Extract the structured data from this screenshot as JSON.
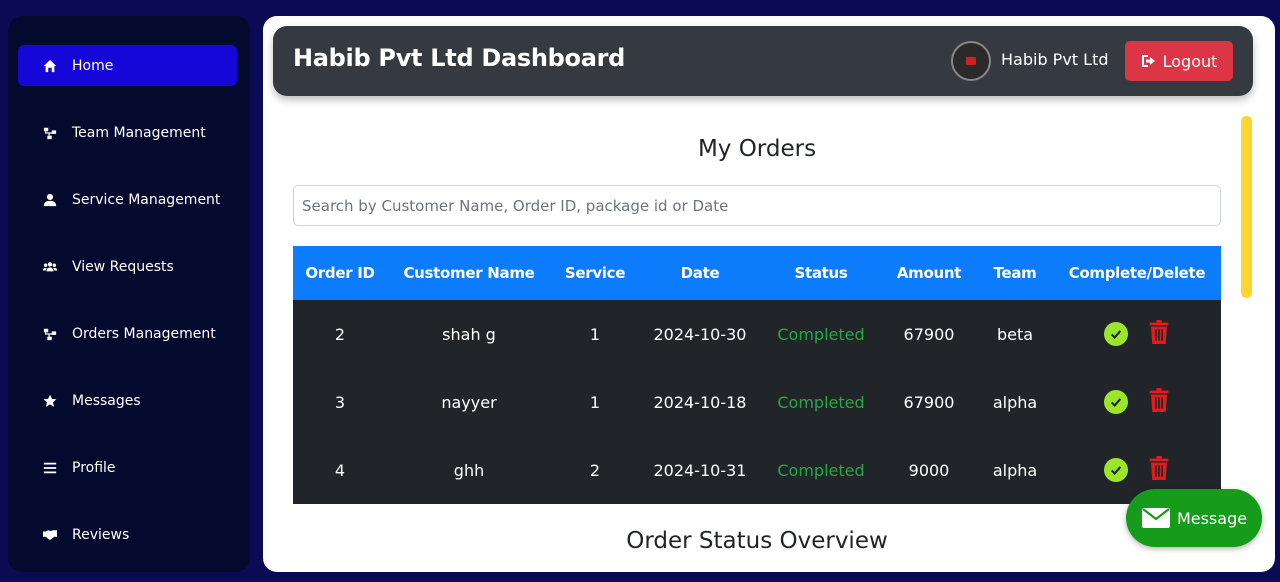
{
  "sidebar": {
    "items": [
      {
        "label": "Home",
        "icon": "home-icon",
        "active": true
      },
      {
        "label": "Team Management",
        "icon": "sitemap-icon"
      },
      {
        "label": "Service Management",
        "icon": "user-icon"
      },
      {
        "label": "View Requests",
        "icon": "users-icon"
      },
      {
        "label": "Orders Management",
        "icon": "sitemap-icon"
      },
      {
        "label": "Messages",
        "icon": "star-icon"
      },
      {
        "label": "Profile",
        "icon": "bars-icon"
      },
      {
        "label": "Reviews",
        "icon": "handshake-icon"
      }
    ]
  },
  "header": {
    "title": "Habib Pvt Ltd Dashboard",
    "company": "Habib Pvt Ltd",
    "logout_label": "Logout"
  },
  "main": {
    "title": "My Orders",
    "search_placeholder": "Search by Customer Name, Order ID, package id or Date",
    "table": {
      "columns": [
        "Order ID",
        "Customer Name",
        "Service",
        "Date",
        "Status",
        "Amount",
        "Team",
        "Complete/Delete"
      ],
      "rows": [
        {
          "id": "2",
          "customer": "shah g",
          "service": "1",
          "date": "2024-10-30",
          "status": "Completed",
          "amount": "67900",
          "team": "beta"
        },
        {
          "id": "3",
          "customer": "nayyer",
          "service": "1",
          "date": "2024-10-18",
          "status": "Completed",
          "amount": "67900",
          "team": "alpha"
        },
        {
          "id": "4",
          "customer": "ghh",
          "service": "2",
          "date": "2024-10-31",
          "status": "Completed",
          "amount": "9000",
          "team": "alpha"
        }
      ]
    },
    "overview_title": "Order Status Overview"
  },
  "message_button": {
    "label": "Message"
  },
  "colors": {
    "background": "#0a0a55",
    "sidebar": "#030a2e",
    "active": "#1507d8",
    "header": "#343a40",
    "table_header": "#0d7cfc",
    "table_body": "#212529",
    "status_completed": "#28a745",
    "logout": "#dc3545",
    "message": "#179b1a",
    "scrollbar": "#fcd62e"
  }
}
